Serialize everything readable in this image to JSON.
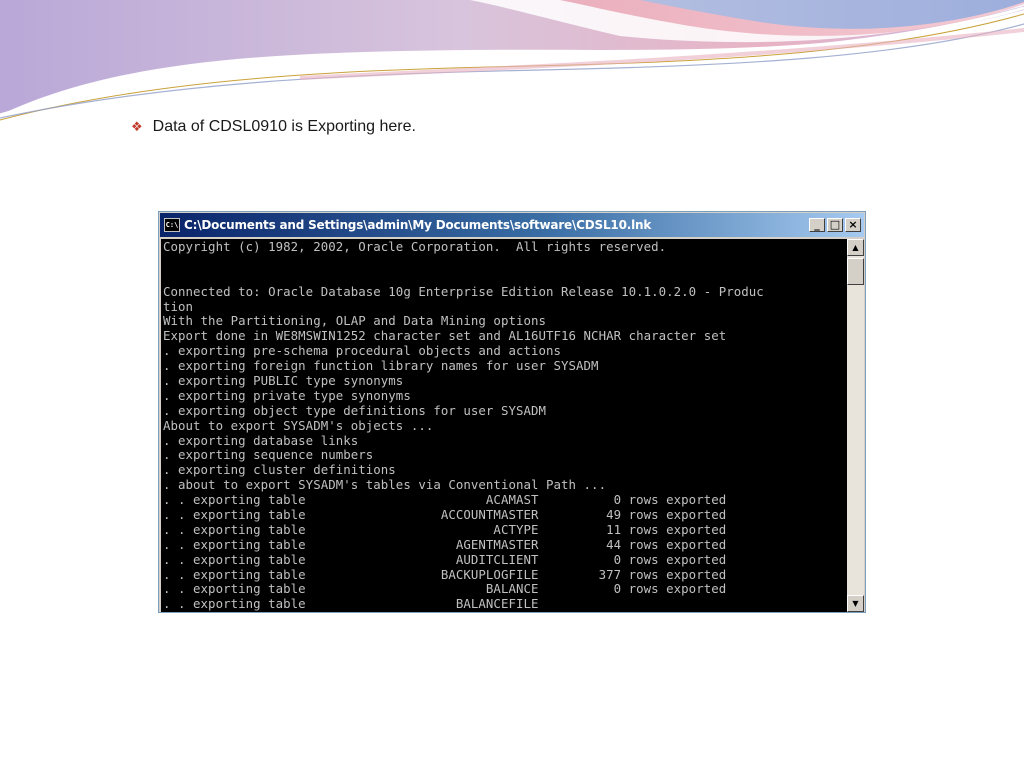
{
  "slide": {
    "bullet_glyph": "❖",
    "bullet_text": "Data of CDSL0910 is Exporting here."
  },
  "console": {
    "title": "C:\\Documents and Settings\\admin\\My Documents\\software\\CDSL10.lnk",
    "icon_text": "C:\\",
    "controls": {
      "minimize": "_",
      "maximize": "□",
      "close": "×"
    },
    "scroll_up": "▲",
    "scroll_down": "▼",
    "lines": [
      "Copyright (c) 1982, 2002, Oracle Corporation.  All rights reserved.",
      "",
      "",
      "Connected to: Oracle Database 10g Enterprise Edition Release 10.1.0.2.0 - Produc",
      "tion",
      "With the Partitioning, OLAP and Data Mining options",
      "Export done in WE8MSWIN1252 character set and AL16UTF16 NCHAR character set",
      ". exporting pre-schema procedural objects and actions",
      ". exporting foreign function library names for user SYSADM",
      ". exporting PUBLIC type synonyms",
      ". exporting private type synonyms",
      ". exporting object type definitions for user SYSADM",
      "About to export SYSADM's objects ...",
      ". exporting database links",
      ". exporting sequence numbers",
      ". exporting cluster definitions",
      ". about to export SYSADM's tables via Conventional Path ...",
      ". . exporting table                        ACAMAST          0 rows exported",
      ". . exporting table                  ACCOUNTMASTER         49 rows exported",
      ". . exporting table                         ACTYPE         11 rows exported",
      ". . exporting table                    AGENTMASTER         44 rows exported",
      ". . exporting table                    AUDITCLIENT          0 rows exported",
      ". . exporting table                  BACKUPLOGFILE        377 rows exported",
      ". . exporting table                        BALANCE          0 rows exported",
      ". . exporting table                    BALANCEFILE"
    ]
  }
}
